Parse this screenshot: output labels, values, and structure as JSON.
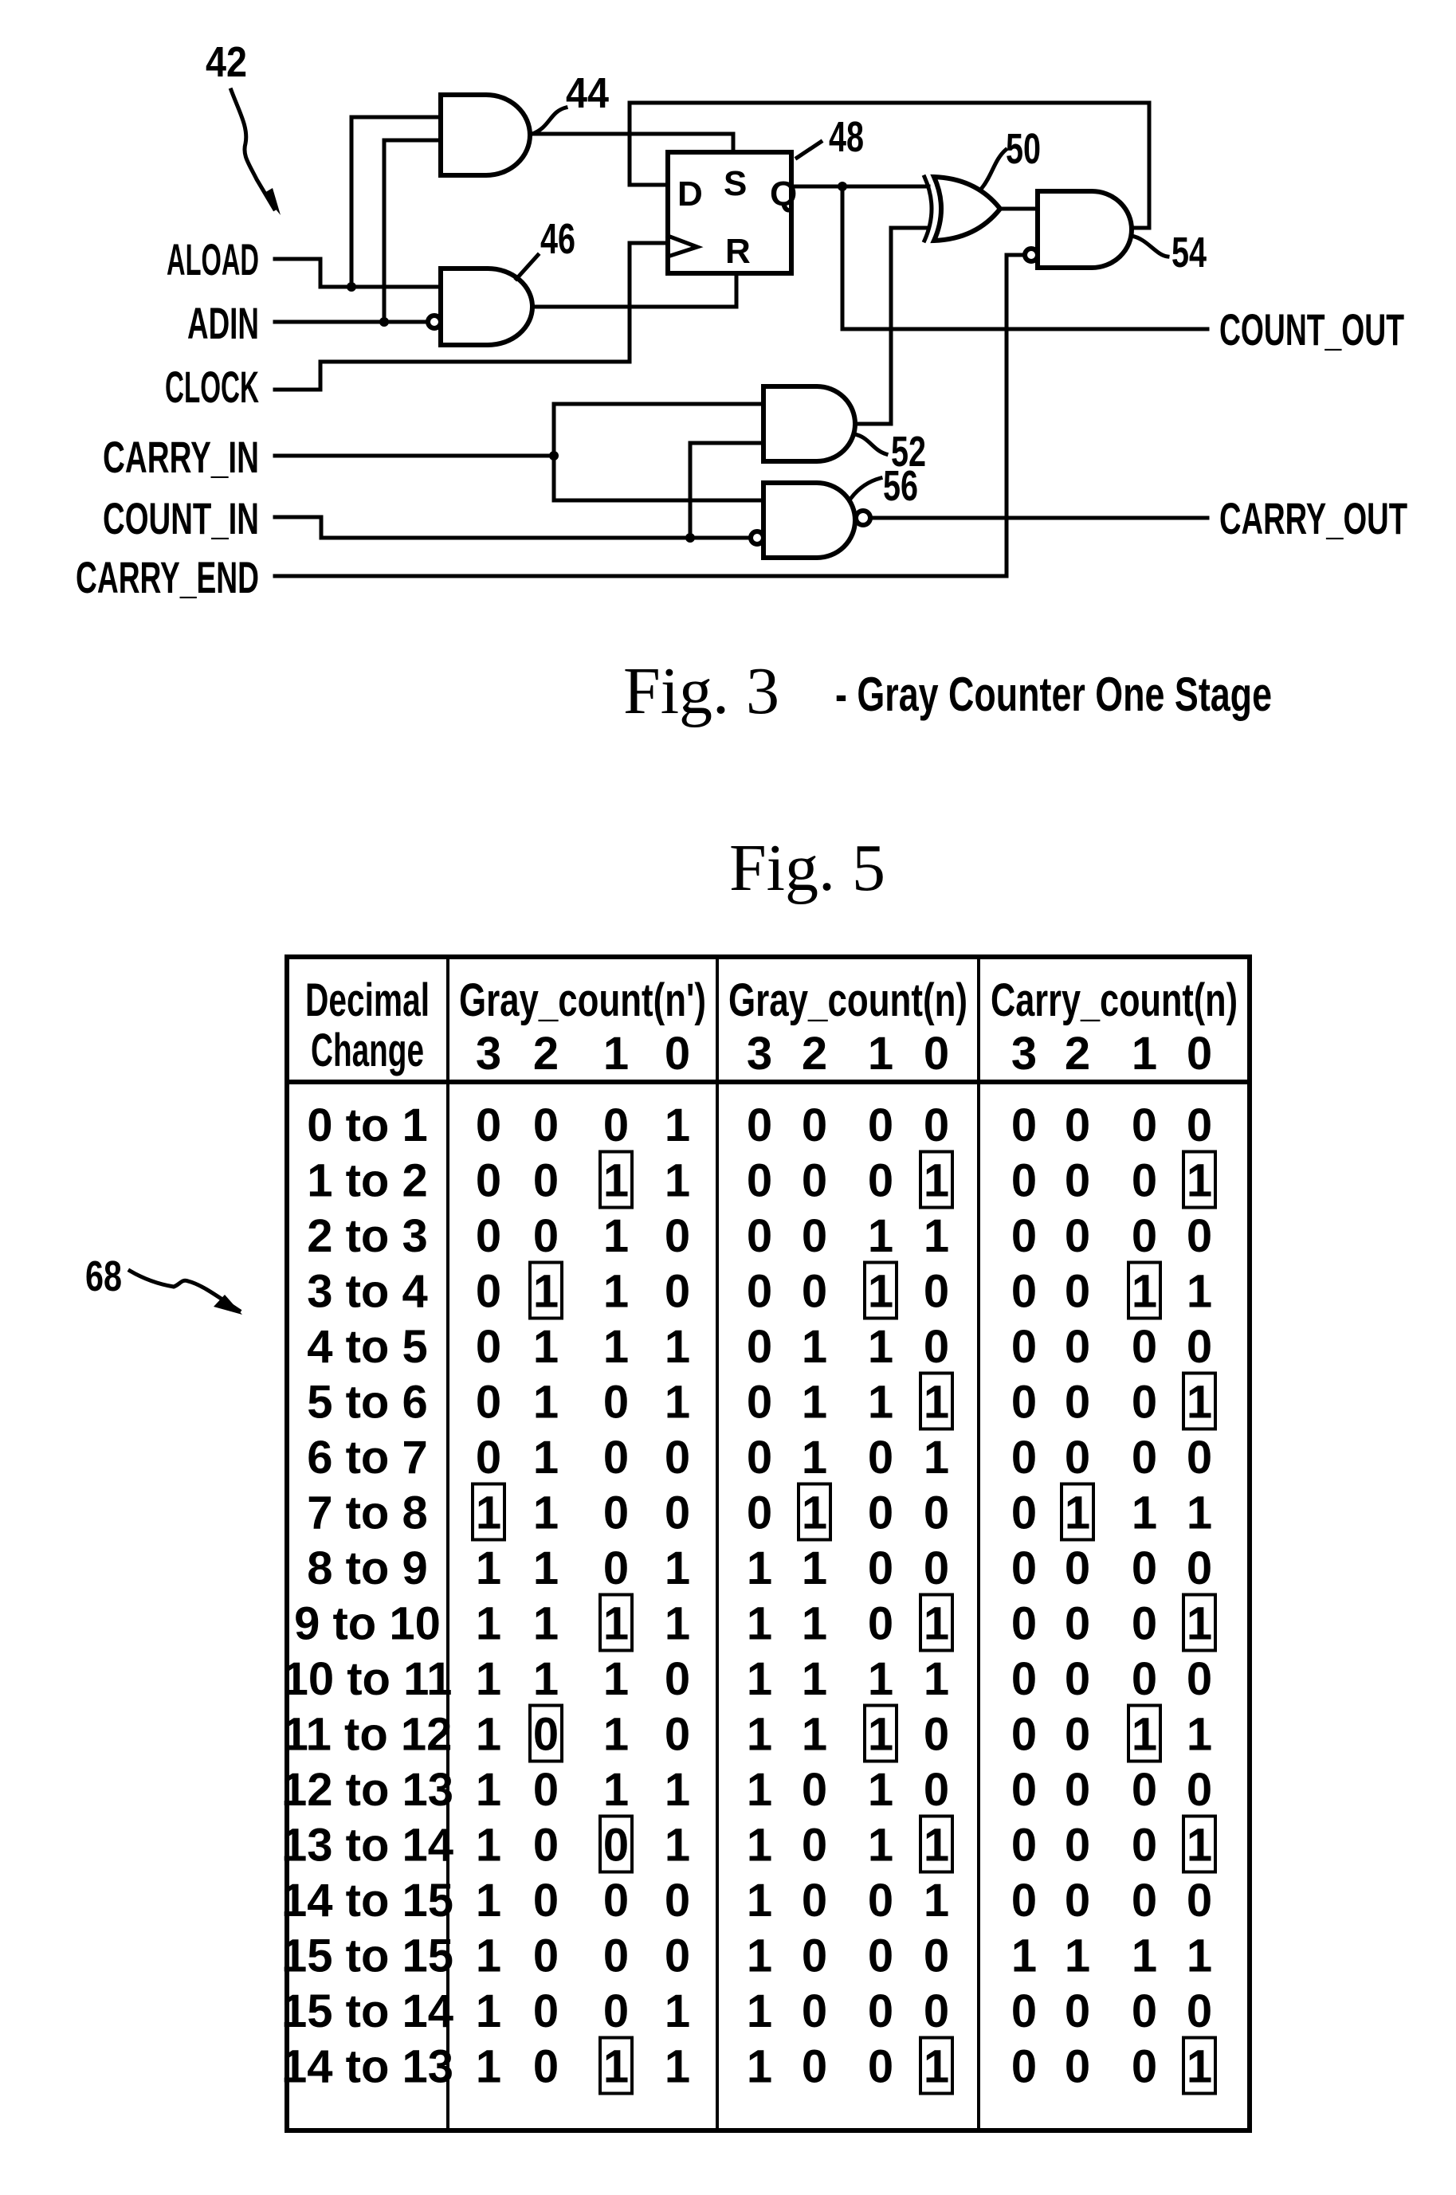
{
  "fig3": {
    "ref_label": "42",
    "inputs": [
      "ALOAD",
      "ADIN",
      "CLOCK",
      "CARRY_IN",
      "COUNT_IN",
      "CARRY_END"
    ],
    "outputs": [
      "COUNT_OUT",
      "CARRY_OUT"
    ],
    "components": {
      "and_44": "44",
      "and_46": "46",
      "flipflop_48": "48",
      "xor_50": "50",
      "and_52": "52",
      "and_54": "54",
      "nand_56": "56"
    },
    "flipflop_pins": {
      "d": "D",
      "s": "S",
      "q": "Q",
      "r": "R"
    },
    "caption_fig": "Fig. 3",
    "caption_title": "- Gray Counter One Stage"
  },
  "fig5": {
    "caption": "Fig. 5",
    "ref_label": "68",
    "header": {
      "col0_line1": "Decimal",
      "col0_line2": "Change",
      "groups": [
        "Gray_count(n')",
        "Gray_count(n)",
        "Carry_count(n)"
      ],
      "bits": [
        "3",
        "2",
        "1",
        "0"
      ]
    },
    "rows": [
      {
        "change": "0 to 1",
        "gray_np": [
          "0",
          "0",
          "0",
          "1"
        ],
        "gray_n": [
          "0",
          "0",
          "0",
          "0"
        ],
        "carry_n": [
          "0",
          "0",
          "0",
          "0"
        ],
        "boxed": []
      },
      {
        "change": "1 to 2",
        "gray_np": [
          "0",
          "0",
          "1",
          "1"
        ],
        "gray_n": [
          "0",
          "0",
          "0",
          "1"
        ],
        "carry_n": [
          "0",
          "0",
          "0",
          "1"
        ],
        "boxed": [
          [
            0,
            2
          ],
          [
            1,
            3
          ],
          [
            2,
            3
          ]
        ]
      },
      {
        "change": "2 to 3",
        "gray_np": [
          "0",
          "0",
          "1",
          "0"
        ],
        "gray_n": [
          "0",
          "0",
          "1",
          "1"
        ],
        "carry_n": [
          "0",
          "0",
          "0",
          "0"
        ],
        "boxed": []
      },
      {
        "change": "3 to 4",
        "gray_np": [
          "0",
          "1",
          "1",
          "0"
        ],
        "gray_n": [
          "0",
          "0",
          "1",
          "0"
        ],
        "carry_n": [
          "0",
          "0",
          "1",
          "1"
        ],
        "boxed": [
          [
            0,
            1
          ],
          [
            1,
            2
          ],
          [
            2,
            2
          ]
        ]
      },
      {
        "change": "4 to 5",
        "gray_np": [
          "0",
          "1",
          "1",
          "1"
        ],
        "gray_n": [
          "0",
          "1",
          "1",
          "0"
        ],
        "carry_n": [
          "0",
          "0",
          "0",
          "0"
        ],
        "boxed": []
      },
      {
        "change": "5 to 6",
        "gray_np": [
          "0",
          "1",
          "0",
          "1"
        ],
        "gray_n": [
          "0",
          "1",
          "1",
          "1"
        ],
        "carry_n": [
          "0",
          "0",
          "0",
          "1"
        ],
        "boxed": [
          [
            1,
            3
          ],
          [
            2,
            3
          ]
        ]
      },
      {
        "change": "6 to 7",
        "gray_np": [
          "0",
          "1",
          "0",
          "0"
        ],
        "gray_n": [
          "0",
          "1",
          "0",
          "1"
        ],
        "carry_n": [
          "0",
          "0",
          "0",
          "0"
        ],
        "boxed": []
      },
      {
        "change": "7 to 8",
        "gray_np": [
          "1",
          "1",
          "0",
          "0"
        ],
        "gray_n": [
          "0",
          "1",
          "0",
          "0"
        ],
        "carry_n": [
          "0",
          "1",
          "1",
          "1"
        ],
        "boxed": [
          [
            0,
            0
          ],
          [
            1,
            1
          ],
          [
            2,
            1
          ]
        ]
      },
      {
        "change": "8 to 9",
        "gray_np": [
          "1",
          "1",
          "0",
          "1"
        ],
        "gray_n": [
          "1",
          "1",
          "0",
          "0"
        ],
        "carry_n": [
          "0",
          "0",
          "0",
          "0"
        ],
        "boxed": []
      },
      {
        "change": "9 to 10",
        "gray_np": [
          "1",
          "1",
          "1",
          "1"
        ],
        "gray_n": [
          "1",
          "1",
          "0",
          "1"
        ],
        "carry_n": [
          "0",
          "0",
          "0",
          "1"
        ],
        "boxed": [
          [
            0,
            2
          ],
          [
            1,
            3
          ],
          [
            2,
            3
          ]
        ]
      },
      {
        "change": "10 to 11",
        "gray_np": [
          "1",
          "1",
          "1",
          "0"
        ],
        "gray_n": [
          "1",
          "1",
          "1",
          "1"
        ],
        "carry_n": [
          "0",
          "0",
          "0",
          "0"
        ],
        "boxed": []
      },
      {
        "change": "11 to 12",
        "gray_np": [
          "1",
          "0",
          "1",
          "0"
        ],
        "gray_n": [
          "1",
          "1",
          "1",
          "0"
        ],
        "carry_n": [
          "0",
          "0",
          "1",
          "1"
        ],
        "boxed": [
          [
            0,
            1
          ],
          [
            1,
            2
          ],
          [
            2,
            2
          ]
        ]
      },
      {
        "change": "12 to 13",
        "gray_np": [
          "1",
          "0",
          "1",
          "1"
        ],
        "gray_n": [
          "1",
          "0",
          "1",
          "0"
        ],
        "carry_n": [
          "0",
          "0",
          "0",
          "0"
        ],
        "boxed": []
      },
      {
        "change": "13 to 14",
        "gray_np": [
          "1",
          "0",
          "0",
          "1"
        ],
        "gray_n": [
          "1",
          "0",
          "1",
          "1"
        ],
        "carry_n": [
          "0",
          "0",
          "0",
          "1"
        ],
        "boxed": [
          [
            0,
            2
          ],
          [
            1,
            3
          ],
          [
            2,
            3
          ]
        ]
      },
      {
        "change": "14 to 15",
        "gray_np": [
          "1",
          "0",
          "0",
          "0"
        ],
        "gray_n": [
          "1",
          "0",
          "0",
          "1"
        ],
        "carry_n": [
          "0",
          "0",
          "0",
          "0"
        ],
        "boxed": []
      },
      {
        "change": "15 to 15",
        "gray_np": [
          "1",
          "0",
          "0",
          "0"
        ],
        "gray_n": [
          "1",
          "0",
          "0",
          "0"
        ],
        "carry_n": [
          "1",
          "1",
          "1",
          "1"
        ],
        "boxed": []
      },
      {
        "change": "15 to 14",
        "gray_np": [
          "1",
          "0",
          "0",
          "1"
        ],
        "gray_n": [
          "1",
          "0",
          "0",
          "0"
        ],
        "carry_n": [
          "0",
          "0",
          "0",
          "0"
        ],
        "boxed": []
      },
      {
        "change": "14 to 13",
        "gray_np": [
          "1",
          "0",
          "1",
          "1"
        ],
        "gray_n": [
          "1",
          "0",
          "0",
          "1"
        ],
        "carry_n": [
          "0",
          "0",
          "0",
          "1"
        ],
        "boxed": [
          [
            0,
            2
          ],
          [
            1,
            3
          ],
          [
            2,
            3
          ]
        ]
      }
    ]
  }
}
